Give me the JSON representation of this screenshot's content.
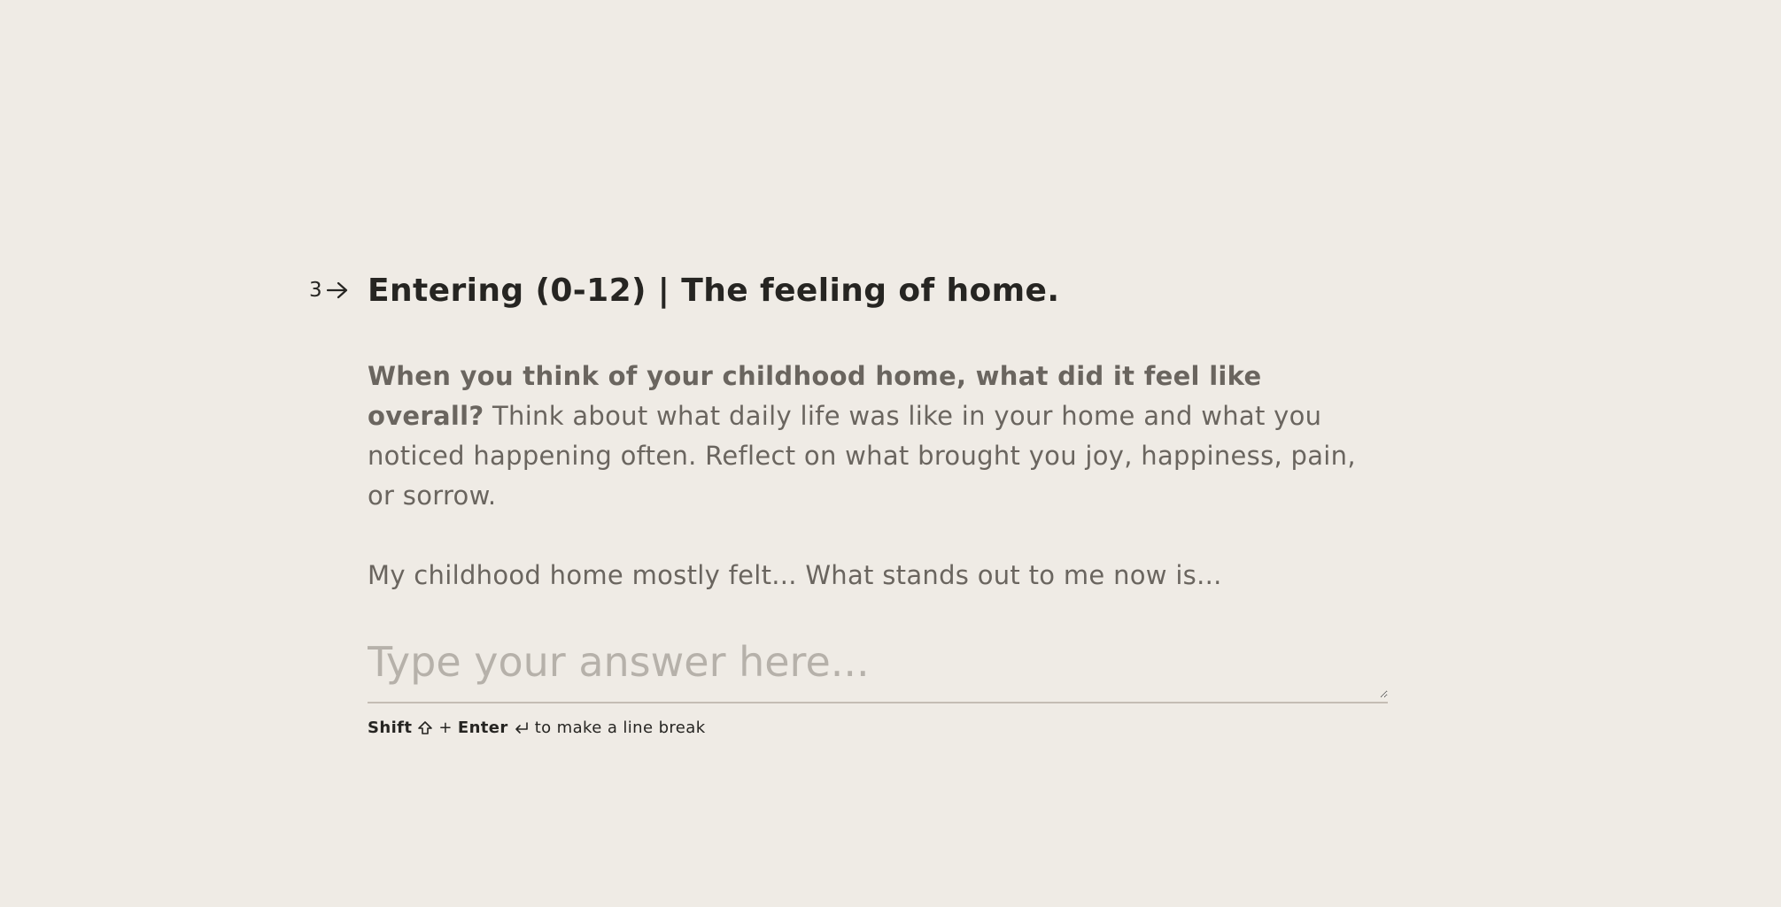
{
  "question": {
    "index": "3",
    "index_icon": "arrow-right-icon",
    "title": "Entering (0-12) | The feeling of home.",
    "description_bold": "When you think of your childhood home, what did it feel like overall?",
    "description_rest": " Think about what daily life was like in your home and what you noticed happening often. Reflect on what brought you joy, happiness, pain, or sorrow.",
    "prompt_line": "My childhood home mostly felt... What stands out to me now is..."
  },
  "answer": {
    "value": "",
    "placeholder": "Type your answer here..."
  },
  "hint": {
    "shift_label": "Shift",
    "shift_icon": "shift-icon",
    "plus": "+",
    "enter_label": "Enter",
    "enter_icon": "enter-icon",
    "suffix": "to make a line break"
  },
  "colors": {
    "background": "#efebe5",
    "title": "#262522",
    "body": "#6a655f",
    "placeholder": "#b6b1aa",
    "underline": "#c4bdb4"
  }
}
